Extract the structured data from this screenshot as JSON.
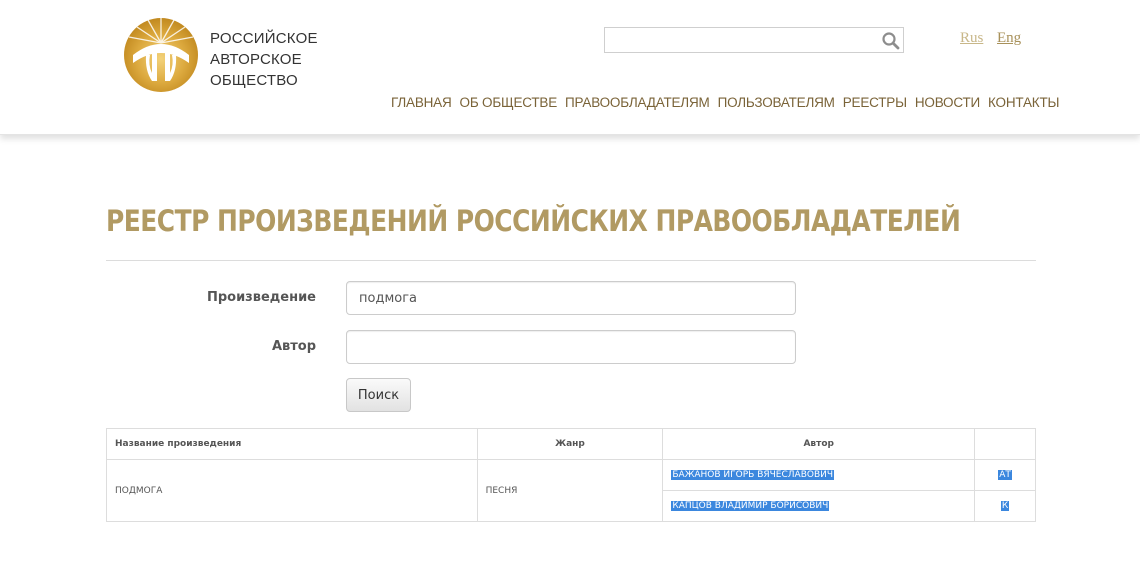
{
  "logo": {
    "line1": "РОССИЙСКОЕ",
    "line2": "АВТОРСКОЕ",
    "line3": "ОБЩЕСТВО"
  },
  "search": {
    "value": "",
    "placeholder": ""
  },
  "lang": {
    "rus": "Rus",
    "eng": "Eng"
  },
  "nav": [
    "ГЛАВНАЯ",
    "ОБ ОБЩЕСТВЕ",
    "ПРАВООБЛАДАТЕЛЯМ",
    "ПОЛЬЗОВАТЕЛЯМ",
    "РЕЕСТРЫ",
    "НОВОСТИ",
    "КОНТАКТЫ"
  ],
  "page_title": "РЕЕСТР ПРОИЗВЕДЕНИЙ РОССИЙСКИХ ПРАВООБЛАДАТЕЛЕЙ",
  "form": {
    "work_label": "Произведение",
    "work_value": "подмога",
    "author_label": "Автор",
    "author_value": "",
    "submit_label": "Поиск"
  },
  "table": {
    "headers": {
      "title": "Название произведения",
      "genre": "Жанр",
      "author": "Автор",
      "role": ""
    },
    "row": {
      "title": "ПОДМОГА",
      "genre": "ПЕСНЯ",
      "authors": [
        {
          "name": "БАЖАНОВ ИГОРЬ ВЯЧЕСЛАВОВИЧ",
          "role": "АТ"
        },
        {
          "name": "КАПЦОВ ВЛАДИМИР БОРИСОВИЧ",
          "role": "К"
        }
      ]
    }
  },
  "colors": {
    "brand_gold": "#b19a63",
    "nav_brown": "#7a6338",
    "selection_blue": "#3b87de"
  }
}
